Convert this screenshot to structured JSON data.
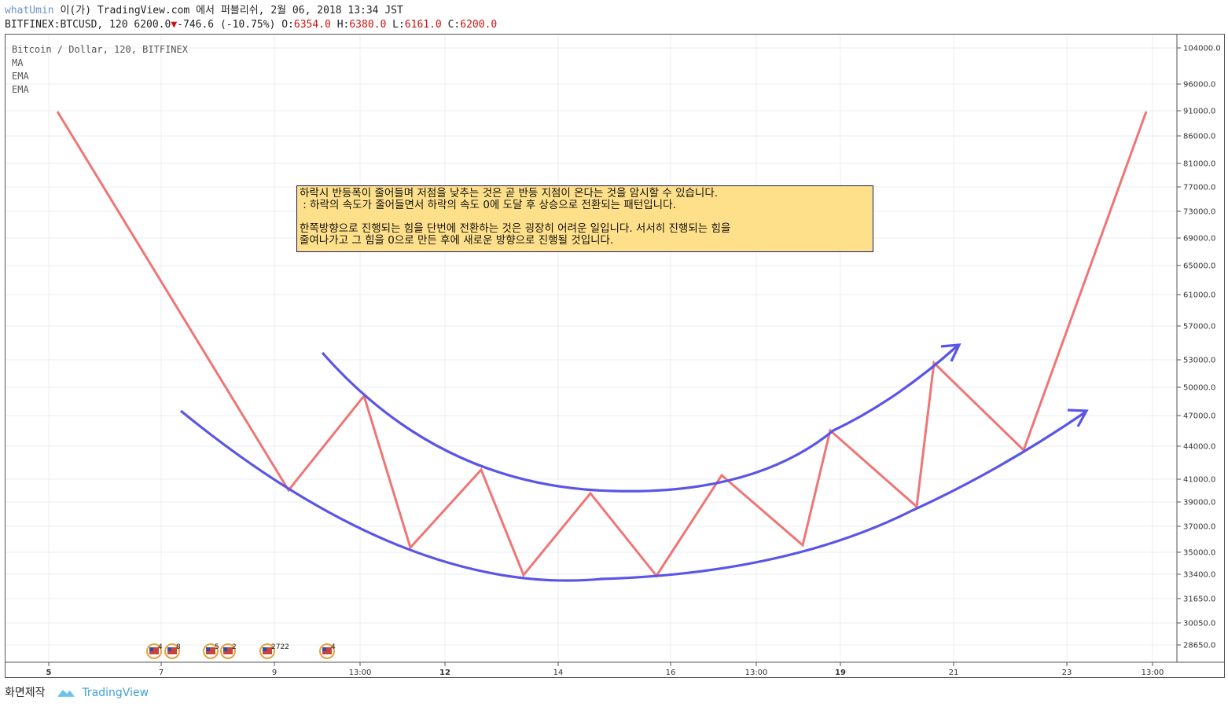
{
  "header": {
    "user": "whatUmin",
    "publish_text": "이(가) TradingView.com 에서 퍼블리쉬, 2월 06, 2018 13:34 JST",
    "symbol": "BITFINEX:BTCUSD, 120",
    "last": "6200.0",
    "change": "-746.6 (-10.75%)",
    "o_label": "O:",
    "o_val": "6354.0",
    "h_label": "H:",
    "h_val": "6380.0",
    "l_label": "L:",
    "l_val": "6161.0",
    "c_label": "C:",
    "c_val": "6200.0"
  },
  "legend": {
    "series": "Bitcoin / Dollar, 120, BITFINEX",
    "ind1": "MA",
    "ind2": "EMA",
    "ind3": "EMA"
  },
  "note": {
    "text": "하락시 반등폭이 줄어들며 저점을 낮추는 것은 곧 반등 지점이 온다는 것을 암시할 수 있습니다.\n : 하락의 속도가 줄어들면서 하락의 속도 0에 도달 후 상승으로 전환되는 패턴입니다.\n\n한쪽방향으로 진행되는 힘을 단번에 전환하는 것은 굉장히 어려운 일입니다. 서서히 진행되는 힘을\n줄여나가고 그 힘을 0으로 만든 후에 새로운 방향으로 진행될 것입니다."
  },
  "chart_data": {
    "type": "line",
    "y_axis_ticks": [
      "104000.0",
      "96000.0",
      "91000.0",
      "86000.0",
      "81000.0",
      "77000.0",
      "73000.0",
      "69000.0",
      "65000.0",
      "61000.0",
      "57000.0",
      "53000.0",
      "50000.0",
      "47000.0",
      "44000.0",
      "41000.0",
      "39000.0",
      "37000.0",
      "35000.0",
      "33400.0",
      "31650.0",
      "30050.0",
      "28650.0"
    ],
    "x_axis_ticks": [
      {
        "label": "5",
        "bold": true
      },
      {
        "label": "7",
        "bold": false
      },
      {
        "label": "9",
        "bold": false
      },
      {
        "label": "13:00",
        "bold": false
      },
      {
        "label": "12",
        "bold": true
      },
      {
        "label": "14",
        "bold": false
      },
      {
        "label": "16",
        "bold": false
      },
      {
        "label": "13:00",
        "bold": false
      },
      {
        "label": "19",
        "bold": true
      },
      {
        "label": "21",
        "bold": false
      },
      {
        "label": "23",
        "bold": false
      },
      {
        "label": "13:00",
        "bold": false
      }
    ],
    "zigzag_color": "#f07575",
    "curve_color": "#5a55e8",
    "events": [
      {
        "label": "4"
      },
      {
        "label": "8"
      },
      {
        "label": "5"
      },
      {
        "label": "2"
      },
      {
        "label": "2722"
      },
      {
        "label": "4"
      }
    ]
  },
  "footer": {
    "caption": "화면제작",
    "brand": "TradingView"
  }
}
